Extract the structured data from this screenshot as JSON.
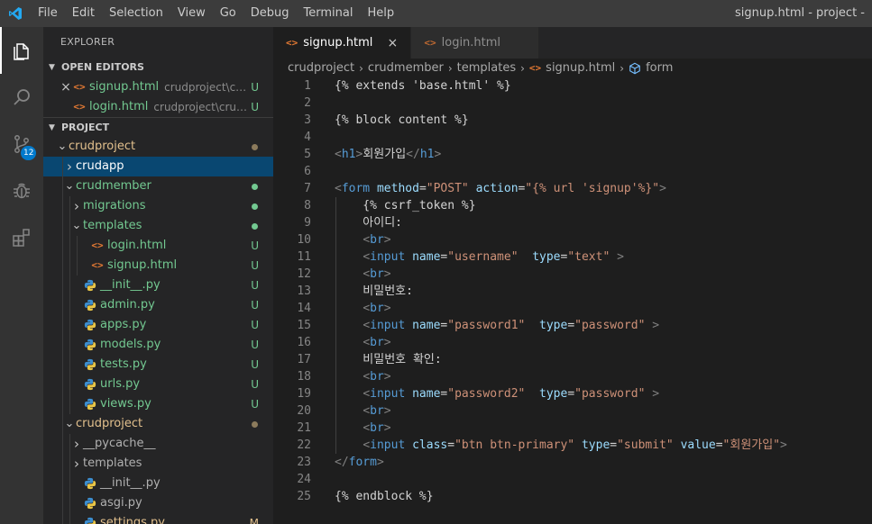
{
  "window": {
    "title": "signup.html - project -"
  },
  "menu": [
    "File",
    "Edit",
    "Selection",
    "View",
    "Go",
    "Debug",
    "Terminal",
    "Help"
  ],
  "activity": {
    "scm_badge": "12"
  },
  "explorer": {
    "title": "EXPLORER",
    "open_editors_label": "OPEN EDITORS",
    "open_editors": [
      {
        "name": "signup.html",
        "path": "crudproject\\crud...",
        "status": "U"
      },
      {
        "name": "login.html",
        "path": "crudproject\\crudm...",
        "status": "U"
      }
    ],
    "project_label": "PROJECT",
    "tree": [
      {
        "name": "crudproject",
        "status": "",
        "dot": "orange"
      },
      {
        "name": "crudapp",
        "status": "",
        "dot": ""
      },
      {
        "name": "crudmember",
        "status": "",
        "dot": "green"
      },
      {
        "name": "migrations",
        "status": "",
        "dot": "green"
      },
      {
        "name": "templates",
        "status": "",
        "dot": "green"
      },
      {
        "name": "login.html",
        "status": "U",
        "dot": ""
      },
      {
        "name": "signup.html",
        "status": "U",
        "dot": ""
      },
      {
        "name": "__init__.py",
        "status": "U",
        "dot": ""
      },
      {
        "name": "admin.py",
        "status": "U",
        "dot": ""
      },
      {
        "name": "apps.py",
        "status": "U",
        "dot": ""
      },
      {
        "name": "models.py",
        "status": "U",
        "dot": ""
      },
      {
        "name": "tests.py",
        "status": "U",
        "dot": ""
      },
      {
        "name": "urls.py",
        "status": "U",
        "dot": ""
      },
      {
        "name": "views.py",
        "status": "U",
        "dot": ""
      },
      {
        "name": "crudproject",
        "status": "",
        "dot": "orange"
      },
      {
        "name": "__pycache__",
        "status": "",
        "dot": ""
      },
      {
        "name": "templates",
        "status": "",
        "dot": ""
      },
      {
        "name": "__init__.py",
        "status": "",
        "dot": ""
      },
      {
        "name": "asgi.py",
        "status": "",
        "dot": ""
      },
      {
        "name": "settings.py",
        "status": "M",
        "dot": ""
      }
    ]
  },
  "tabs": [
    {
      "label": "signup.html",
      "close": "×"
    },
    {
      "label": "login.html"
    }
  ],
  "breadcrumb": [
    "crudproject",
    "crudmember",
    "templates",
    "signup.html",
    "form"
  ],
  "code": {
    "line_numbers": [
      "1",
      "2",
      "3",
      "4",
      "5",
      "6",
      "7",
      "8",
      "9",
      "10",
      "11",
      "12",
      "13",
      "14",
      "15",
      "16",
      "17",
      "18",
      "19",
      "20",
      "21",
      "22",
      "23",
      "24",
      "25"
    ],
    "lines": [
      "{% extends 'base.html' %}",
      "",
      "{% block content %}",
      "",
      "<h1>회원가입</h1>",
      "",
      "<form method=\"POST\" action=\"{% url 'signup'%}\">",
      "    {% csrf_token %}",
      "    아이디:",
      "    <br>",
      "    <input name=\"username\"  type=\"text\" >",
      "    <br>",
      "    비밀번호:",
      "    <br>",
      "    <input name=\"password1\"  type=\"password\" >",
      "    <br>",
      "    비밀번호 확인:",
      "    <br>",
      "    <input name=\"password2\"  type=\"password\" >",
      "    <br>",
      "    <br>",
      "    <input class=\"btn btn-primary\" type=\"submit\" value=\"회원가입\">",
      "</form>",
      "",
      "{% endblock %}"
    ]
  },
  "colors": {
    "accent": "#007acc",
    "untracked": "#73c991",
    "modified": "#e2c08d"
  }
}
